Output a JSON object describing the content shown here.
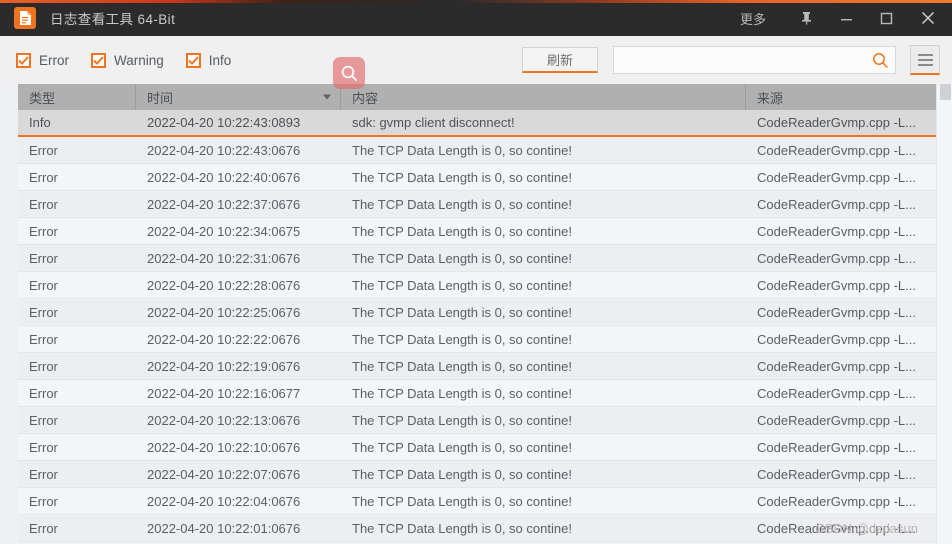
{
  "titlebar": {
    "app_icon": "document-icon",
    "title": "日志查看工具 64-Bit",
    "more_label": "更多",
    "pin_icon": "pin-icon",
    "minimize_icon": "minimize-icon",
    "maximize_icon": "maximize-icon",
    "close_icon": "close-icon",
    "background": "#2b2b2b",
    "accent": "#f0741f"
  },
  "toolbar": {
    "filters": [
      {
        "label": "Error",
        "checked": true
      },
      {
        "label": "Warning",
        "checked": true
      },
      {
        "label": "Info",
        "checked": true
      }
    ],
    "refresh_label": "刷新",
    "search": {
      "value": "",
      "placeholder": "",
      "icon": "search-icon"
    },
    "menu_icon": "hamburger-menu-icon",
    "cursor_badge_icon": "search-icon"
  },
  "table": {
    "columns": [
      {
        "key": "type",
        "label": "类型",
        "sorted": false
      },
      {
        "key": "time",
        "label": "时间",
        "sorted": true,
        "sort_dir": "desc"
      },
      {
        "key": "content",
        "label": "内容",
        "sorted": false
      },
      {
        "key": "source",
        "label": "来源",
        "sorted": false
      }
    ],
    "rows": [
      {
        "type": "Info",
        "time": "2022-04-20 10:22:43:0893",
        "content": "sdk: gvmp client disconnect!",
        "source": "CodeReaderGvmp.cpp  -L...",
        "selected": true
      },
      {
        "type": "Error",
        "time": "2022-04-20 10:22:43:0676",
        "content": "The TCP Data Length is 0, so contine!",
        "source": "CodeReaderGvmp.cpp  -L...",
        "selected": false
      },
      {
        "type": "Error",
        "time": "2022-04-20 10:22:40:0676",
        "content": "The TCP Data Length is 0, so contine!",
        "source": "CodeReaderGvmp.cpp  -L...",
        "selected": false
      },
      {
        "type": "Error",
        "time": "2022-04-20 10:22:37:0676",
        "content": "The TCP Data Length is 0, so contine!",
        "source": "CodeReaderGvmp.cpp  -L...",
        "selected": false
      },
      {
        "type": "Error",
        "time": "2022-04-20 10:22:34:0675",
        "content": "The TCP Data Length is 0, so contine!",
        "source": "CodeReaderGvmp.cpp  -L...",
        "selected": false
      },
      {
        "type": "Error",
        "time": "2022-04-20 10:22:31:0676",
        "content": "The TCP Data Length is 0, so contine!",
        "source": "CodeReaderGvmp.cpp  -L...",
        "selected": false
      },
      {
        "type": "Error",
        "time": "2022-04-20 10:22:28:0676",
        "content": "The TCP Data Length is 0, so contine!",
        "source": "CodeReaderGvmp.cpp  -L...",
        "selected": false
      },
      {
        "type": "Error",
        "time": "2022-04-20 10:22:25:0676",
        "content": "The TCP Data Length is 0, so contine!",
        "source": "CodeReaderGvmp.cpp  -L...",
        "selected": false
      },
      {
        "type": "Error",
        "time": "2022-04-20 10:22:22:0676",
        "content": "The TCP Data Length is 0, so contine!",
        "source": "CodeReaderGvmp.cpp  -L...",
        "selected": false
      },
      {
        "type": "Error",
        "time": "2022-04-20 10:22:19:0676",
        "content": "The TCP Data Length is 0, so contine!",
        "source": "CodeReaderGvmp.cpp  -L...",
        "selected": false
      },
      {
        "type": "Error",
        "time": "2022-04-20 10:22:16:0677",
        "content": "The TCP Data Length is 0, so contine!",
        "source": "CodeReaderGvmp.cpp  -L...",
        "selected": false
      },
      {
        "type": "Error",
        "time": "2022-04-20 10:22:13:0676",
        "content": "The TCP Data Length is 0, so contine!",
        "source": "CodeReaderGvmp.cpp  -L...",
        "selected": false
      },
      {
        "type": "Error",
        "time": "2022-04-20 10:22:10:0676",
        "content": "The TCP Data Length is 0, so contine!",
        "source": "CodeReaderGvmp.cpp  -L...",
        "selected": false
      },
      {
        "type": "Error",
        "time": "2022-04-20 10:22:07:0676",
        "content": "The TCP Data Length is 0, so contine!",
        "source": "CodeReaderGvmp.cpp  -L...",
        "selected": false
      },
      {
        "type": "Error",
        "time": "2022-04-20 10:22:04:0676",
        "content": "The TCP Data Length is 0, so contine!",
        "source": "CodeReaderGvmp.cpp  -L...",
        "selected": false
      },
      {
        "type": "Error",
        "time": "2022-04-20 10:22:01:0676",
        "content": "The TCP Data Length is 0, so contine!",
        "source": "CodeReaderGvmp.cpp  -L...",
        "selected": false
      }
    ]
  },
  "watermark": "CSDN @dsdasun"
}
